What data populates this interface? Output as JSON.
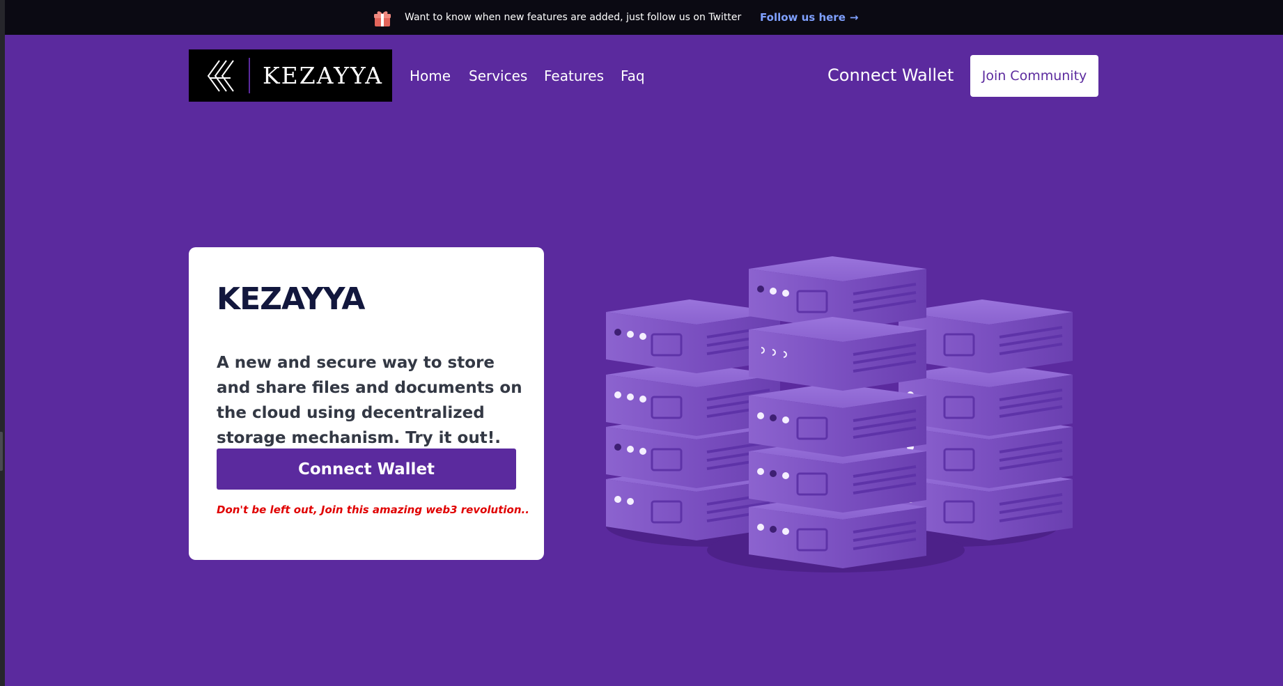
{
  "announcement": {
    "icon": "gift-icon",
    "message": "Want to know when new features are added, just follow us on Twitter",
    "link_label": "Follow us here",
    "link_icon": "arrow-right-icon"
  },
  "brand": {
    "name": "KEZAYYA",
    "logo_icon": "kezayya-logo-mark"
  },
  "nav": {
    "items": [
      {
        "label": "Home"
      },
      {
        "label": "Services"
      },
      {
        "label": "Features"
      },
      {
        "label": "Faq"
      }
    ],
    "connect_wallet": "Connect Wallet",
    "join_community": "Join Community"
  },
  "hero": {
    "title": "KEZAYYA",
    "description": "A new and secure way to store and share files and documents on the cloud using decentralized storage mechanism. Try it out!.",
    "cta_label": "Connect Wallet",
    "note": "Don't be left out, Join this amazing web3 revolution.."
  },
  "illustration": {
    "icon": "server-racks-illustration"
  },
  "colors": {
    "background": "#5b2a9e",
    "topbar": "#0b0a13",
    "link": "#7fa0ff",
    "title": "#12173d",
    "note": "#e00000"
  }
}
